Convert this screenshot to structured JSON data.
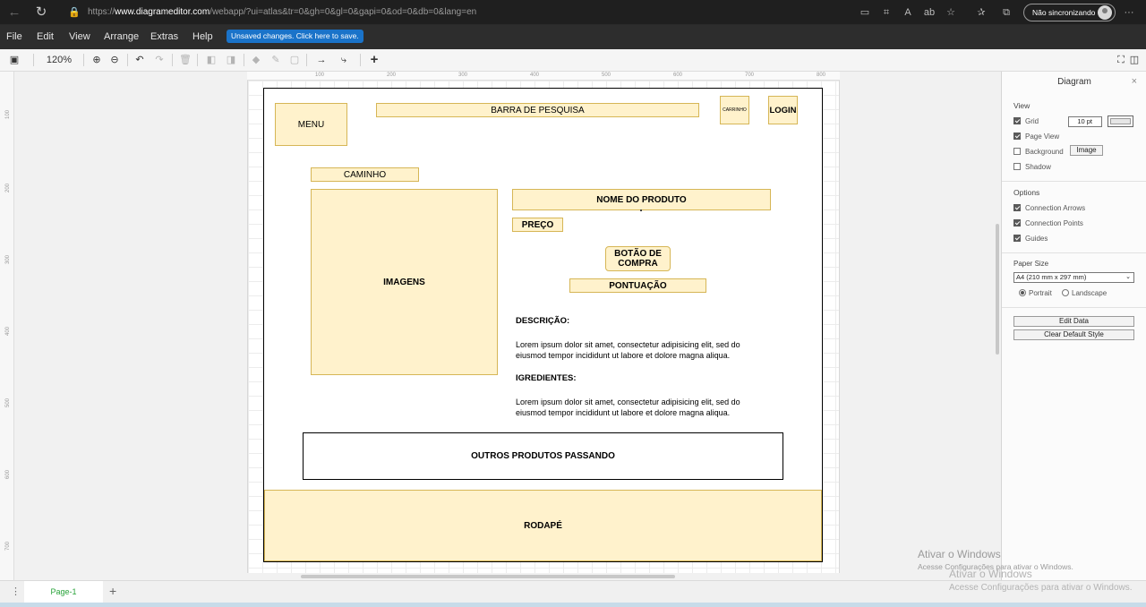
{
  "browser": {
    "back_icon": "←",
    "reload_icon": "↻",
    "lock_icon": "🔒",
    "url_prefix": "https://",
    "url_host": "www.diagrameditor.com",
    "url_path": "/webapp/?ui=atlas&tr=0&gh=0&gl=0&gapi=0&od=0&db=0&lang=en",
    "tool_icons": [
      "▭",
      "⌗",
      "A",
      "ab",
      "☆",
      "✰",
      "⧉"
    ],
    "sync_label": "Não sincronizando",
    "more_icon": "···"
  },
  "menu": {
    "items": [
      "File",
      "Edit",
      "View",
      "Arrange",
      "Extras",
      "Help"
    ],
    "unsaved_notice": "Unsaved changes. Click here to save."
  },
  "toolbar": {
    "page_view_icon": "▣",
    "zoom": "120%",
    "zoom_in_icon": "⊕",
    "zoom_out_icon": "⊖",
    "undo_icon": "↶",
    "redo_icon": "↷",
    "delete_icon": "🗑",
    "to_front_icon": "◧",
    "to_back_icon": "◨",
    "fill_icon": "◆",
    "line_color_icon": "✎",
    "shadow_icon": "▢",
    "connection_icon": "→",
    "waypoint_icon": "⤷",
    "insert_icon": "+",
    "fullscreen_icon": "⛶",
    "format_panel_icon": "◫"
  },
  "ruler": {
    "top_labels": [
      "100",
      "200",
      "300",
      "400",
      "500",
      "600",
      "700",
      "800"
    ],
    "left_labels": [
      "100",
      "200",
      "300",
      "400",
      "500",
      "600",
      "700"
    ]
  },
  "diagram": {
    "menu": "MENU",
    "search": "BARRA DE PESQUISA",
    "cart": "CARRINHO",
    "login": "LOGIN",
    "path": "CAMINHO",
    "images": "IMAGENS",
    "product_name": "NOME DO PRODUTO",
    "price": "PREÇO",
    "buy_button": "BOTÃO DE COMPRA",
    "rating": "PONTUAÇÃO",
    "description_title": "DESCRIÇÃO:",
    "description_text": "Lorem ipsum dolor sit amet, consectetur adipisicing elit, sed do eiusmod tempor incididunt ut labore et dolore magna aliqua.",
    "ingredients_title": "IGREDIENTES:",
    "ingredients_text": "Lorem ipsum dolor sit amet, consectetur adipisicing elit, sed do eiusmod tempor incididunt ut labore et dolore magna aliqua.",
    "other_products": "OUTROS PRODUTOS PASSANDO",
    "footer": "RODAPÉ"
  },
  "panel": {
    "title": "Diagram",
    "close_icon": "×",
    "view_heading": "View",
    "grid_label": "Grid",
    "grid_size": "10 pt",
    "page_view_label": "Page View",
    "background_label": "Background",
    "image_button": "Image",
    "shadow_label": "Shadow",
    "options_heading": "Options",
    "connection_arrows_label": "Connection Arrows",
    "connection_points_label": "Connection Points",
    "guides_label": "Guides",
    "paper_size_heading": "Paper Size",
    "paper_size_value": "A4 (210 mm x 297 mm)",
    "portrait_label": "Portrait",
    "landscape_label": "Landscape",
    "edit_data_button": "Edit Data",
    "clear_style_button": "Clear Default Style"
  },
  "pages": {
    "menu_icon": "⋮",
    "current_tab": "Page-1",
    "add_icon": "+"
  },
  "watermark": {
    "title": "Ativar o Windows",
    "subtitle": "Acesse Configurações para ativar o Windows."
  }
}
